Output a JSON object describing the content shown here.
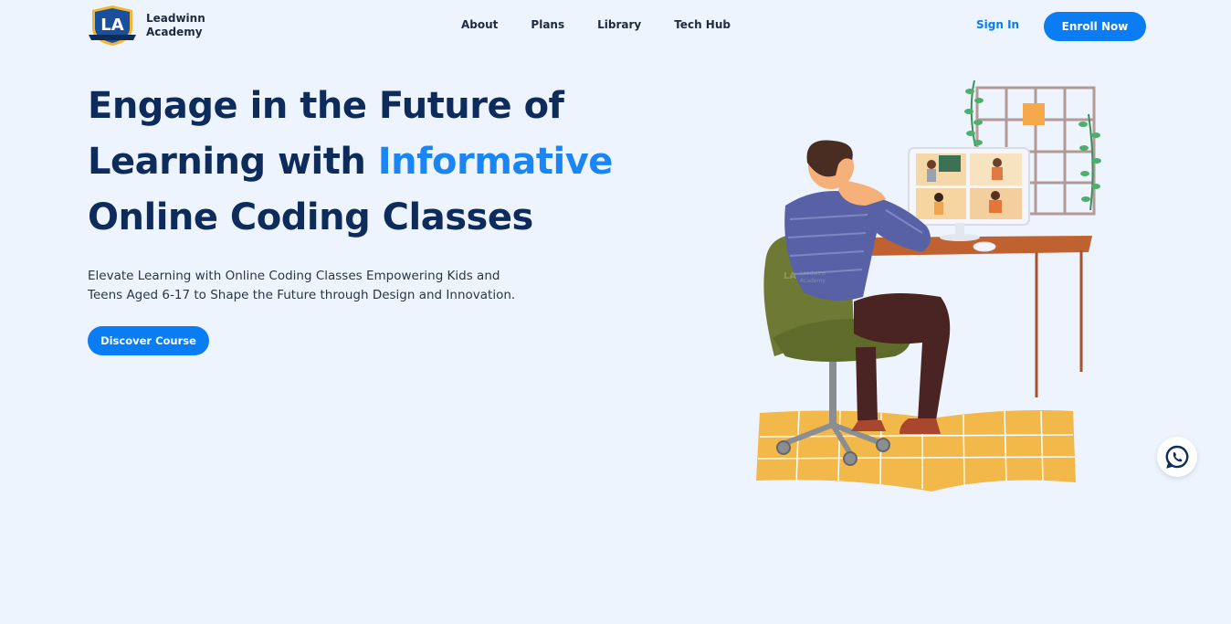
{
  "brand": {
    "line1": "Leadwinn",
    "line2": "Academy",
    "badge_text": "LA",
    "badge_ribbon": "LEADWINN ACADEMY"
  },
  "nav": {
    "items": [
      "About",
      "Plans",
      "Library",
      "Tech Hub"
    ]
  },
  "header": {
    "signin_label": "Sign In",
    "enroll_label": "Enroll Now"
  },
  "hero": {
    "title_line1": "Engage in the Future of",
    "title_line2_plain": "Learning with ",
    "title_line2_accent": "Informative",
    "title_line3": "Online Coding Classes",
    "subtitle_line1": "Elevate Learning with Online Coding Classes Empowering Kids and",
    "subtitle_line2": "Teens Aged 6-17 to Shape the Future through Design and Innovation.",
    "cta_label": "Discover Course"
  },
  "illustration": {
    "watermark_line1": "Leadwinn",
    "watermark_line2": "Academy",
    "watermark_badge": "LA"
  },
  "icons": {
    "whatsapp": "whatsapp-icon"
  },
  "colors": {
    "primary": "#0a7cf4",
    "heading": "#0d2b5b",
    "accent": "#1a85f5",
    "background": "#edf4fd"
  }
}
